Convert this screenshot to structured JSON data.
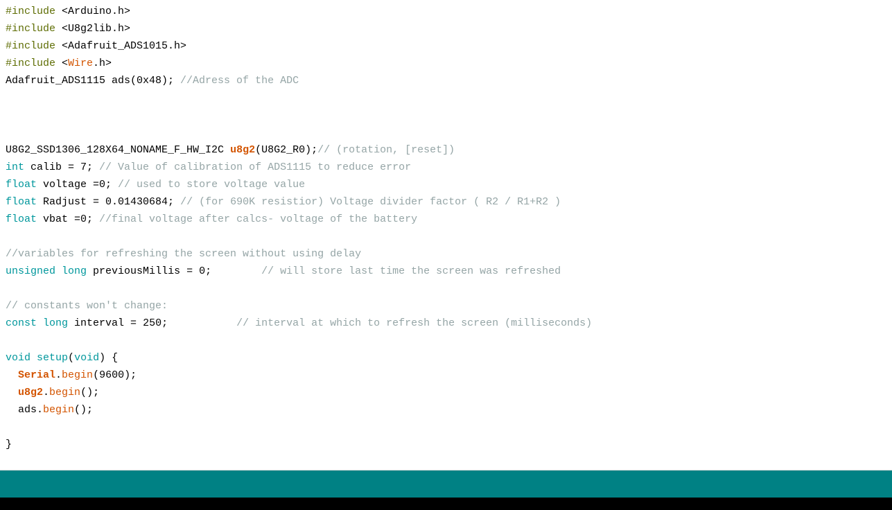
{
  "code": {
    "lines": [
      [
        {
          "cls": "tok-preproc",
          "t": "#include"
        },
        {
          "cls": "tok-plain",
          "t": " <Arduino.h>"
        }
      ],
      [
        {
          "cls": "tok-preproc",
          "t": "#include"
        },
        {
          "cls": "tok-plain",
          "t": " <U8g2lib.h>"
        }
      ],
      [
        {
          "cls": "tok-preproc",
          "t": "#include"
        },
        {
          "cls": "tok-plain",
          "t": " <Adafruit_ADS1015.h>"
        }
      ],
      [
        {
          "cls": "tok-preproc",
          "t": "#include"
        },
        {
          "cls": "tok-plain",
          "t": " <"
        },
        {
          "cls": "tok-func",
          "t": "Wire"
        },
        {
          "cls": "tok-plain",
          "t": ".h>"
        }
      ],
      [
        {
          "cls": "tok-plain",
          "t": "Adafruit_ADS1115 ads(0x48); "
        },
        {
          "cls": "tok-comment",
          "t": "//Adress of the ADC"
        }
      ],
      [
        {
          "cls": "tok-plain",
          "t": ""
        }
      ],
      [
        {
          "cls": "tok-plain",
          "t": ""
        }
      ],
      [
        {
          "cls": "tok-plain",
          "t": ""
        }
      ],
      [
        {
          "cls": "tok-plain",
          "t": "U8G2_SSD1306_128X64_NONAME_F_HW_I2C "
        },
        {
          "cls": "tok-bold-id",
          "t": "u8g2"
        },
        {
          "cls": "tok-plain",
          "t": "(U8G2_R0);"
        },
        {
          "cls": "tok-comment",
          "t": "// (rotation, [reset])"
        }
      ],
      [
        {
          "cls": "tok-keyword",
          "t": "int"
        },
        {
          "cls": "tok-plain",
          "t": " calib = 7; "
        },
        {
          "cls": "tok-comment",
          "t": "// Value of calibration of ADS1115 to reduce error"
        }
      ],
      [
        {
          "cls": "tok-keyword",
          "t": "float"
        },
        {
          "cls": "tok-plain",
          "t": " voltage =0; "
        },
        {
          "cls": "tok-comment",
          "t": "// used to store voltage value"
        }
      ],
      [
        {
          "cls": "tok-keyword",
          "t": "float"
        },
        {
          "cls": "tok-plain",
          "t": " Radjust = 0.01430684; "
        },
        {
          "cls": "tok-comment",
          "t": "// (for 690K resistior) Voltage divider factor ( R2 / R1+R2 )"
        }
      ],
      [
        {
          "cls": "tok-keyword",
          "t": "float"
        },
        {
          "cls": "tok-plain",
          "t": " vbat =0; "
        },
        {
          "cls": "tok-comment",
          "t": "//final voltage after calcs- voltage of the battery"
        }
      ],
      [
        {
          "cls": "tok-plain",
          "t": ""
        }
      ],
      [
        {
          "cls": "tok-comment",
          "t": "//variables for refreshing the screen without using delay"
        }
      ],
      [
        {
          "cls": "tok-keyword",
          "t": "unsigned"
        },
        {
          "cls": "tok-plain",
          "t": " "
        },
        {
          "cls": "tok-keyword",
          "t": "long"
        },
        {
          "cls": "tok-plain",
          "t": " previousMillis = 0;        "
        },
        {
          "cls": "tok-comment",
          "t": "// will store last time the screen was refreshed"
        }
      ],
      [
        {
          "cls": "tok-plain",
          "t": ""
        }
      ],
      [
        {
          "cls": "tok-comment",
          "t": "// constants won't change:"
        }
      ],
      [
        {
          "cls": "tok-keyword",
          "t": "const"
        },
        {
          "cls": "tok-plain",
          "t": " "
        },
        {
          "cls": "tok-keyword",
          "t": "long"
        },
        {
          "cls": "tok-plain",
          "t": " interval = 250;           "
        },
        {
          "cls": "tok-comment",
          "t": "// interval at which to refresh the screen (milliseconds)"
        }
      ],
      [
        {
          "cls": "tok-plain",
          "t": ""
        }
      ],
      [
        {
          "cls": "tok-keyword",
          "t": "void"
        },
        {
          "cls": "tok-plain",
          "t": " "
        },
        {
          "cls": "tok-keyword",
          "t": "setup"
        },
        {
          "cls": "tok-plain",
          "t": "("
        },
        {
          "cls": "tok-keyword",
          "t": "void"
        },
        {
          "cls": "tok-plain",
          "t": ") {"
        }
      ],
      [
        {
          "cls": "tok-plain",
          "t": "  "
        },
        {
          "cls": "tok-bold-id",
          "t": "Serial"
        },
        {
          "cls": "tok-plain",
          "t": "."
        },
        {
          "cls": "tok-func",
          "t": "begin"
        },
        {
          "cls": "tok-plain",
          "t": "(9600);"
        }
      ],
      [
        {
          "cls": "tok-plain",
          "t": "  "
        },
        {
          "cls": "tok-bold-id",
          "t": "u8g2"
        },
        {
          "cls": "tok-plain",
          "t": "."
        },
        {
          "cls": "tok-func",
          "t": "begin"
        },
        {
          "cls": "tok-plain",
          "t": "();"
        }
      ],
      [
        {
          "cls": "tok-plain",
          "t": "  ads."
        },
        {
          "cls": "tok-func",
          "t": "begin"
        },
        {
          "cls": "tok-plain",
          "t": "();"
        }
      ],
      [
        {
          "cls": "tok-plain",
          "t": ""
        }
      ],
      [
        {
          "cls": "tok-plain",
          "t": "}"
        }
      ]
    ]
  },
  "colors": {
    "status_teal": "#008184",
    "status_black": "#000000"
  }
}
